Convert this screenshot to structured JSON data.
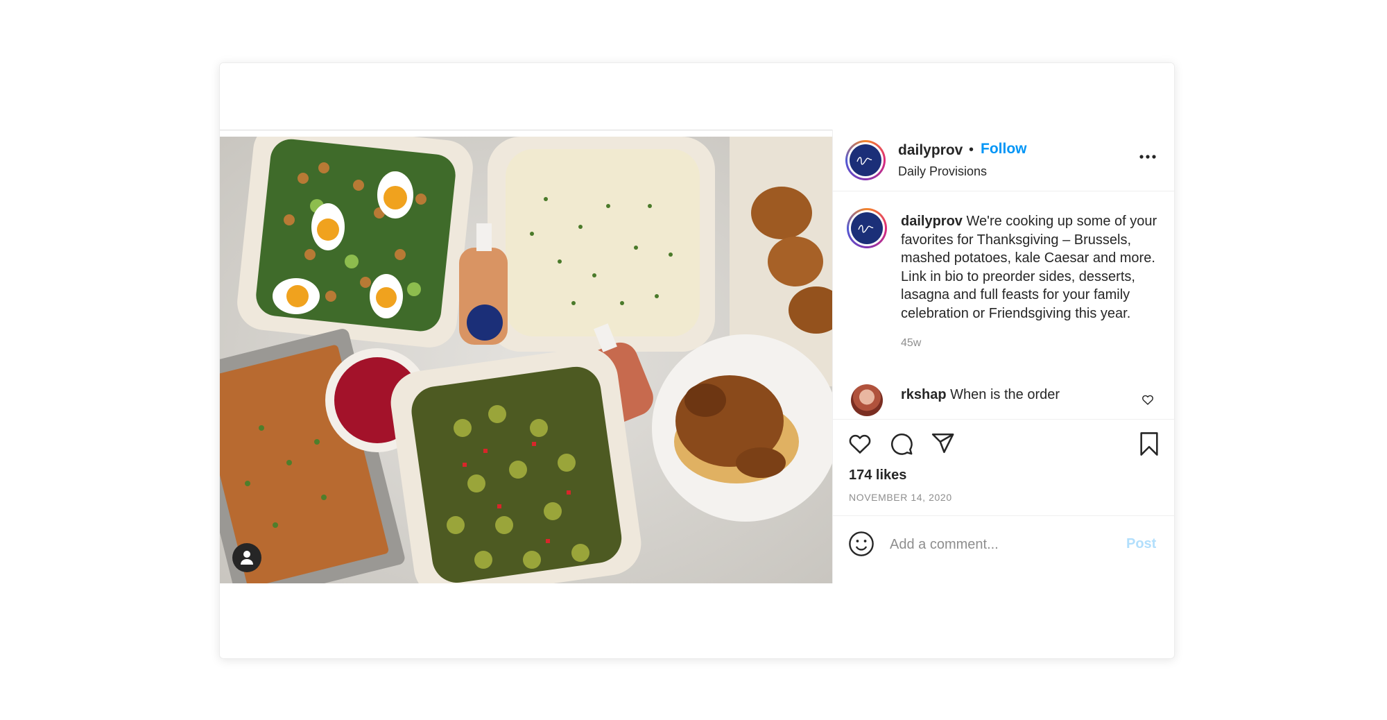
{
  "post": {
    "username": "dailyprov",
    "separator": "•",
    "follow_label": "Follow",
    "full_name": "Daily Provisions",
    "caption_username": "dailyprov",
    "caption": "We're cooking up some of your favorites for Thanksgiving – Brussels, mashed potatoes, kale Caesar and more. Link in bio to preorder sides, desserts, lasagna and full feasts for your family celebration or Friendsgiving this year.",
    "age": "45w",
    "likes": "174 likes",
    "date": "NOVEMBER 14, 2020"
  },
  "comments": [
    {
      "username": "rkshap",
      "text": "When is the order"
    }
  ],
  "comment_box": {
    "placeholder": "Add a comment...",
    "post_label": "Post"
  },
  "icons": {
    "header_more": "more-horizontal-icon",
    "like": "heart-icon",
    "comment": "comment-bubble-icon",
    "share": "paper-plane-icon",
    "save": "bookmark-icon",
    "emoji": "smiley-icon",
    "tagged_people": "person-icon",
    "comment_like": "small-heart-icon"
  },
  "colors": {
    "follow": "#0095f6",
    "post_disabled": "#b2dffc",
    "logo_bg": "#1b2f78",
    "text": "#262626",
    "muted": "#8e8e8e"
  }
}
